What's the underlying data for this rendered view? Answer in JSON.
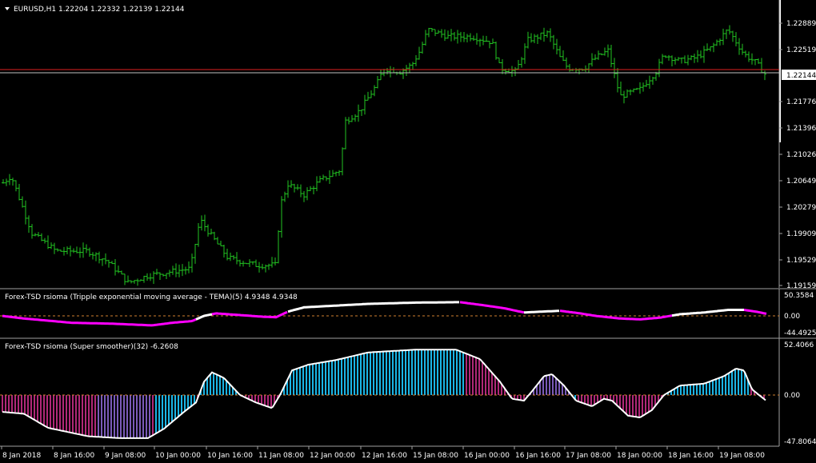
{
  "colors": {
    "background": "#000000",
    "candle": "#22c322",
    "bid_line": "#e02020",
    "tema_up": "#ffffff",
    "tema_down": "#ff00ff",
    "hist_up": "#1ab4e4",
    "hist_down": "#b02878",
    "hist_mid": "#7a5ab8",
    "smoother_line": "#ffffff",
    "zero_line": "#d08030",
    "separator": "#a0a0a0"
  },
  "main": {
    "header": "EURUSD,H1  1.22204 1.22332 1.22139 1.22144",
    "current_price": "1.22144",
    "price_labels": [
      "1.22889",
      "1.22519",
      "1.21776",
      "1.21396",
      "1.21026",
      "1.20649",
      "1.20279",
      "1.19909",
      "1.19529",
      "1.19159"
    ]
  },
  "tema_panel": {
    "header": "Forex-TSD rsioma (Tripple exponential moving average - TEMA)(5) 4.9348 4.9348",
    "labels": [
      "50.3584",
      "0.00",
      "-44.4925"
    ]
  },
  "smoother_panel": {
    "header": "Forex-TSD rsioma (Super smoother)(32) -6.2608",
    "labels": [
      "52.4066",
      "0.00",
      "-47.8064"
    ]
  },
  "time_axis": [
    "8 Jan 2018",
    "8 Jan 16:00",
    "9 Jan 08:00",
    "10 Jan 00:00",
    "10 Jan 16:00",
    "11 Jan 08:00",
    "12 Jan 00:00",
    "12 Jan 16:00",
    "15 Jan 08:00",
    "16 Jan 00:00",
    "16 Jan 16:00",
    "17 Jan 08:00",
    "18 Jan 00:00",
    "18 Jan 16:00",
    "19 Jan 08:00"
  ],
  "chart_data": [
    {
      "type": "line",
      "title": "EURUSD,H1",
      "ylim": [
        1.1916,
        1.2289
      ],
      "price_path": [
        [
          0,
          1.2058
        ],
        [
          14,
          1.2072
        ],
        [
          40,
          1.199
        ],
        [
          70,
          1.1965
        ],
        [
          110,
          1.1965
        ],
        [
          135,
          1.195
        ],
        [
          160,
          1.192
        ],
        [
          185,
          1.193
        ],
        [
          210,
          1.1935
        ],
        [
          238,
          1.194
        ],
        [
          250,
          1.201
        ],
        [
          262,
          1.199
        ],
        [
          285,
          1.1955
        ],
        [
          320,
          1.1945
        ],
        [
          345,
          1.1945
        ],
        [
          350,
          1.203
        ],
        [
          360,
          1.206
        ],
        [
          380,
          1.2045
        ],
        [
          400,
          1.2065
        ],
        [
          425,
          1.208
        ],
        [
          432,
          1.215
        ],
        [
          450,
          1.2165
        ],
        [
          470,
          1.22
        ],
        [
          480,
          1.2225
        ],
        [
          500,
          1.222
        ],
        [
          515,
          1.223
        ],
        [
          525,
          1.225
        ],
        [
          535,
          1.228
        ],
        [
          560,
          1.227
        ],
        [
          590,
          1.227
        ],
        [
          615,
          1.2262
        ],
        [
          625,
          1.2225
        ],
        [
          645,
          1.222
        ],
        [
          660,
          1.2265
        ],
        [
          685,
          1.2275
        ],
        [
          700,
          1.224
        ],
        [
          710,
          1.2225
        ],
        [
          730,
          1.2225
        ],
        [
          745,
          1.224
        ],
        [
          760,
          1.225
        ],
        [
          775,
          1.2185
        ],
        [
          800,
          1.2195
        ],
        [
          820,
          1.222
        ],
        [
          830,
          1.2245
        ],
        [
          850,
          1.2235
        ],
        [
          870,
          1.224
        ],
        [
          890,
          1.2255
        ],
        [
          910,
          1.228
        ],
        [
          930,
          1.2245
        ],
        [
          945,
          1.2233
        ],
        [
          958,
          1.2214
        ]
      ]
    },
    {
      "type": "line",
      "title": "Forex-TSD rsioma (Tripple exponential moving average - TEMA)(5)",
      "ylim": [
        -44.4925,
        50.3584
      ],
      "points": [
        [
          3,
          0
        ],
        [
          30,
          -6
        ],
        [
          90,
          -16
        ],
        [
          140,
          -18
        ],
        [
          190,
          -22
        ],
        [
          215,
          -16
        ],
        [
          240,
          -12
        ],
        [
          255,
          0
        ],
        [
          270,
          6
        ],
        [
          300,
          2
        ],
        [
          330,
          -2
        ],
        [
          345,
          -3
        ],
        [
          360,
          10
        ],
        [
          380,
          20
        ],
        [
          420,
          24
        ],
        [
          460,
          28
        ],
        [
          520,
          31
        ],
        [
          575,
          32
        ],
        [
          600,
          26
        ],
        [
          630,
          18
        ],
        [
          655,
          8
        ],
        [
          700,
          12
        ],
        [
          725,
          6
        ],
        [
          745,
          0
        ],
        [
          775,
          -6
        ],
        [
          800,
          -8
        ],
        [
          825,
          -4
        ],
        [
          850,
          4
        ],
        [
          880,
          8
        ],
        [
          910,
          14
        ],
        [
          930,
          14
        ],
        [
          945,
          10
        ],
        [
          958,
          5
        ]
      ],
      "series_segments": [
        [
          "down",
          3,
          245
        ],
        [
          "up",
          245,
          265
        ],
        [
          "down",
          265,
          360
        ],
        [
          "up",
          360,
          575
        ],
        [
          "down",
          575,
          655
        ],
        [
          "up",
          655,
          700
        ],
        [
          "down",
          700,
          840
        ],
        [
          "up",
          840,
          930
        ],
        [
          "down",
          930,
          958
        ]
      ]
    },
    {
      "type": "area",
      "title": "Forex-TSD rsioma (Super smoother)(32)",
      "ylim": [
        -47.8064,
        52.4066
      ],
      "points": [
        [
          3,
          -18
        ],
        [
          30,
          -20
        ],
        [
          60,
          -35
        ],
        [
          110,
          -44
        ],
        [
          150,
          -46
        ],
        [
          185,
          -46
        ],
        [
          205,
          -36
        ],
        [
          230,
          -18
        ],
        [
          245,
          -8
        ],
        [
          255,
          14
        ],
        [
          265,
          24
        ],
        [
          280,
          18
        ],
        [
          300,
          0
        ],
        [
          320,
          -8
        ],
        [
          340,
          -14
        ],
        [
          350,
          0
        ],
        [
          365,
          26
        ],
        [
          385,
          32
        ],
        [
          420,
          37
        ],
        [
          460,
          45
        ],
        [
          520,
          48
        ],
        [
          570,
          48
        ],
        [
          600,
          38
        ],
        [
          625,
          14
        ],
        [
          640,
          -4
        ],
        [
          655,
          -6
        ],
        [
          665,
          4
        ],
        [
          680,
          20
        ],
        [
          690,
          22
        ],
        [
          705,
          10
        ],
        [
          720,
          -6
        ],
        [
          740,
          -12
        ],
        [
          755,
          -4
        ],
        [
          765,
          -6
        ],
        [
          785,
          -22
        ],
        [
          800,
          -24
        ],
        [
          815,
          -16
        ],
        [
          830,
          0
        ],
        [
          850,
          10
        ],
        [
          880,
          12
        ],
        [
          905,
          20
        ],
        [
          920,
          28
        ],
        [
          930,
          26
        ],
        [
          940,
          6
        ],
        [
          958,
          -6.26
        ]
      ],
      "color_bands": [
        [
          "down",
          3,
          120
        ],
        [
          "mid",
          120,
          190
        ],
        [
          "down",
          190,
          192
        ],
        [
          "up",
          192,
          245
        ],
        [
          "down",
          300,
          350
        ],
        [
          "up",
          350,
          580
        ],
        [
          "down",
          580,
          640
        ],
        [
          "mid",
          660,
          718
        ],
        [
          "up",
          718,
          720
        ],
        [
          "down",
          720,
          830
        ],
        [
          "up",
          830,
          935
        ],
        [
          "down",
          935,
          958
        ]
      ]
    }
  ]
}
